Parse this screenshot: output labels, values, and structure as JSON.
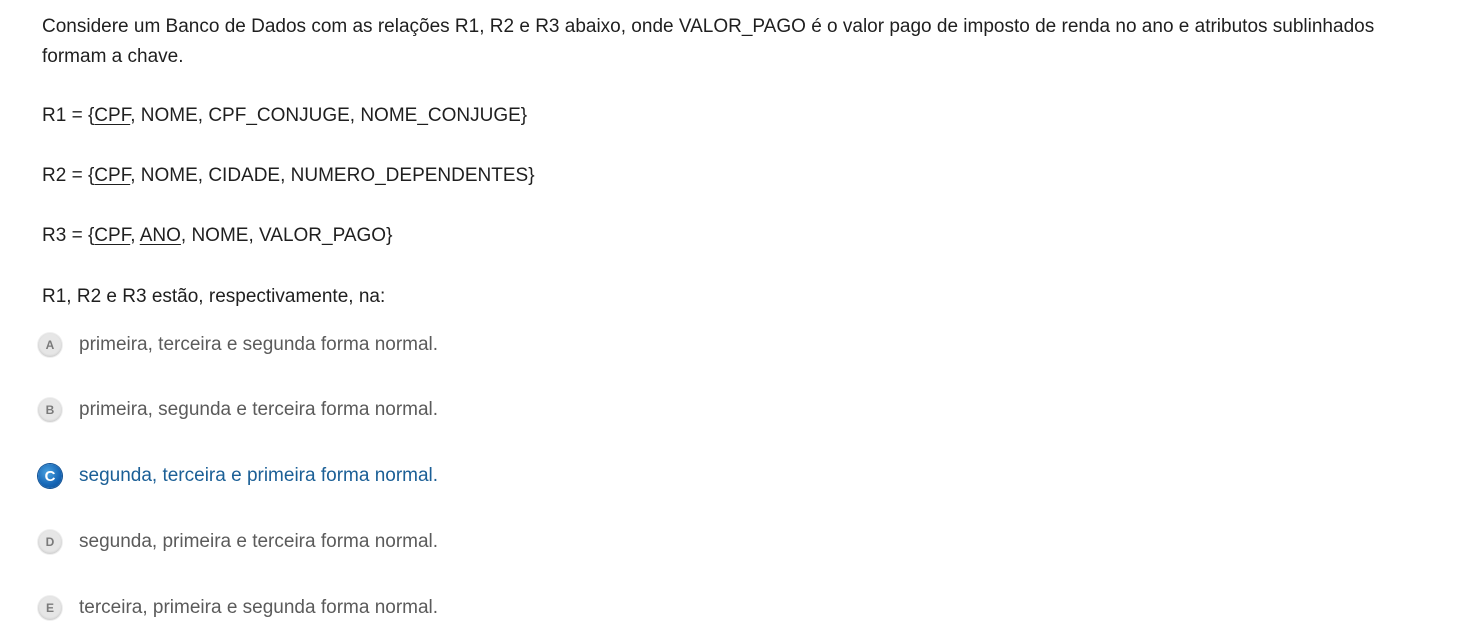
{
  "question": {
    "intro": "Considere um Banco de Dados com as relações R1, R2 e R3 abaixo, onde VALOR_PAGO é o valor pago de imposto de renda no ano e atributos sublinhados formam a chave.",
    "r1": {
      "prefix": "R1 = {",
      "key1": "CPF",
      "rest": ", NOME, CPF_CONJUGE, NOME_CONJUGE}"
    },
    "r2": {
      "prefix": "R2 = {",
      "key1": "CPF",
      "rest": ", NOME, CIDADE, NUMERO_DEPENDENTES}"
    },
    "r3": {
      "prefix": "R3 = {",
      "key1": "CPF",
      "sep": ", ",
      "key2": "ANO",
      "rest": ", NOME, VALOR_PAGO}"
    },
    "prompt": "R1, R2 e R3 estão, respectivamente, na:"
  },
  "options": [
    {
      "letter": "A",
      "text": "primeira, terceira e segunda forma normal.",
      "selected": false
    },
    {
      "letter": "B",
      "text": "primeira, segunda e terceira forma normal.",
      "selected": false
    },
    {
      "letter": "C",
      "text": "segunda, terceira e primeira forma normal.",
      "selected": true
    },
    {
      "letter": "D",
      "text": "segunda, primeira e terceira forma normal.",
      "selected": false
    },
    {
      "letter": "E",
      "text": "terceira, primeira e segunda forma normal.",
      "selected": false
    }
  ],
  "colors": {
    "selected_text": "#1b5f96",
    "selected_badge": "#1565b5",
    "option_text": "#5b5b5b",
    "badge_bg": "#e6e6e6"
  },
  "icons": {
    "option_badge": "letter-circle-icon"
  }
}
